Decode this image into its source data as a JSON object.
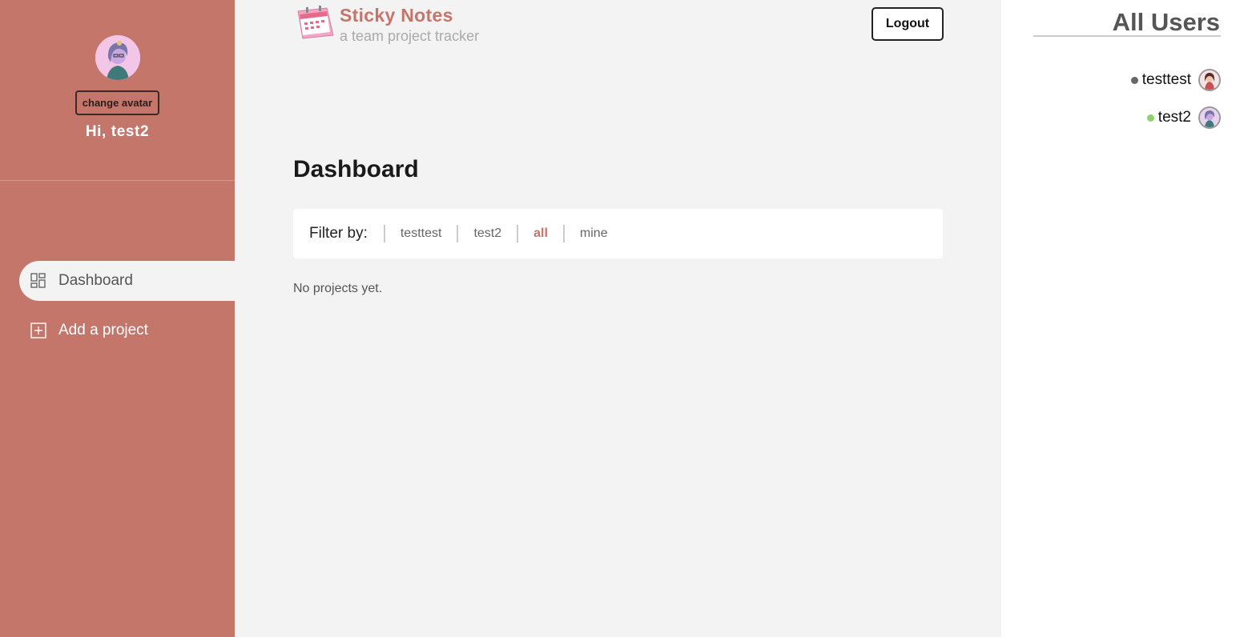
{
  "brand": {
    "title": "Sticky Notes",
    "subtitle": "a team project tracker",
    "logo_icon": "calendar-icon"
  },
  "sidebar": {
    "avatar_icon": "user-avatar",
    "change_avatar_label": "change avatar",
    "greeting": "Hi, test2",
    "nav": [
      {
        "label": "Dashboard",
        "icon": "grid-icon",
        "active": true
      },
      {
        "label": "Add a project",
        "icon": "plus-square-icon",
        "active": false
      }
    ]
  },
  "header": {
    "logout_label": "Logout"
  },
  "main": {
    "title": "Dashboard",
    "filter": {
      "label": "Filter by:",
      "options": [
        {
          "label": "testtest",
          "active": false
        },
        {
          "label": "test2",
          "active": false
        },
        {
          "label": "all",
          "active": true
        },
        {
          "label": "mine",
          "active": false
        }
      ]
    },
    "empty_message": "No projects yet."
  },
  "users": {
    "title": "All Users",
    "list": [
      {
        "name": "testtest",
        "status": "offline",
        "status_color": "#666666"
      },
      {
        "name": "test2",
        "status": "online",
        "status_color": "#8fd16a"
      }
    ]
  },
  "colors": {
    "accent": "#c4766b",
    "background": "#f3f3f3",
    "panel": "#ffffff"
  }
}
